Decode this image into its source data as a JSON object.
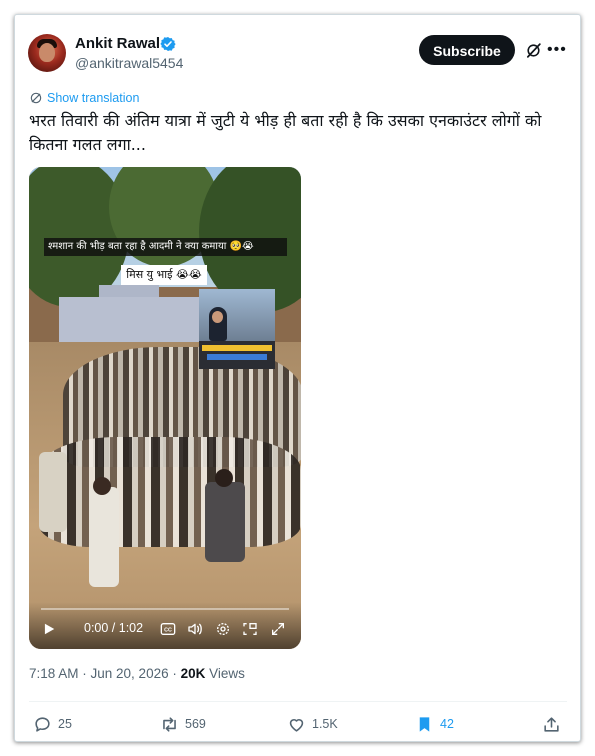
{
  "author": {
    "name": "Ankit Rawal",
    "handle": "@ankitrawal5454",
    "verified": true
  },
  "header": {
    "subscribe_label": "Subscribe",
    "grok_icon": "grok-icon",
    "more_icon": "more-icon"
  },
  "translate": {
    "label": "Show translation",
    "icon": "globe-icon"
  },
  "tweet": {
    "text": "भरत तिवारी की अंतिम यात्रा में जुटी ये भीड़ ही बता रही है कि उसका एनकाउंटर लोगों को कितना गलत लगा..."
  },
  "video": {
    "caption_top": "श्मशान की भीड़ बता रहा है आदमी ने क्या कमाया 🥺😭",
    "caption_mid": "मिस यु भाई 😭😭",
    "time": "0:00 / 1:02",
    "progress": 0,
    "icons": [
      "play-icon",
      "captions-icon",
      "volume-icon",
      "settings-icon",
      "pip-icon",
      "fullscreen-icon"
    ]
  },
  "meta": {
    "time": "7:18 AM · Jun 20, 2026 · ",
    "views_count": "20K",
    "views_label": " Views"
  },
  "actions": {
    "replies": "25",
    "reposts": "569",
    "likes": "1.5K",
    "bookmarks": "42"
  },
  "colors": {
    "accent": "#1d9bf0",
    "text": "#0f1419",
    "muted": "#536471"
  }
}
